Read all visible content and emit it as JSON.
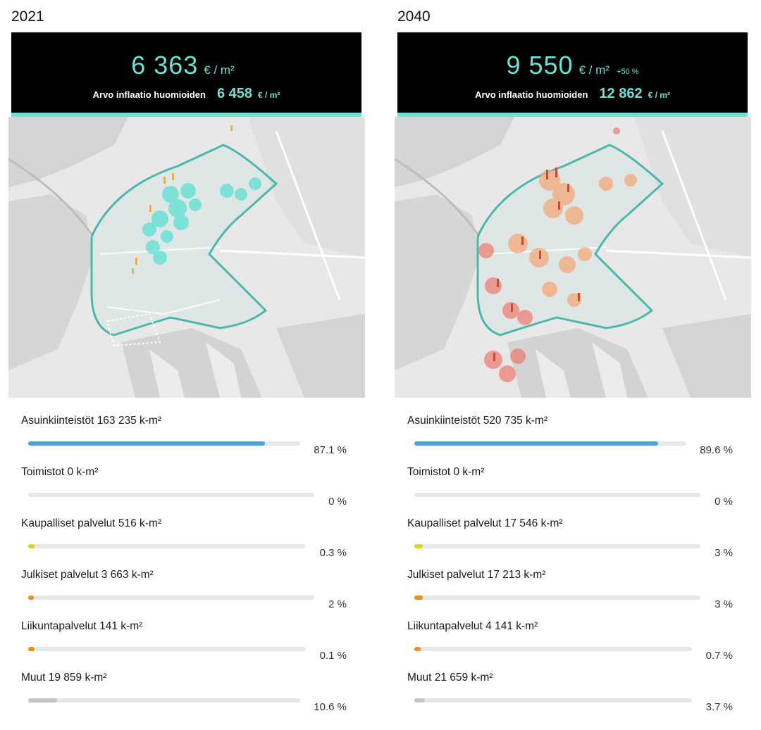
{
  "colors": {
    "accent": "#6ee0d6",
    "bar_blue": "#4aa3d8",
    "bar_yellow": "#d9d71c",
    "bar_orange": "#e8901a",
    "bar_gray": "#c4c4c4"
  },
  "panels": [
    {
      "year": "2021",
      "price": "6 363",
      "price_unit": "€ / m²",
      "price_change": "",
      "inflation_label": "Arvo inflaatio huomioiden",
      "inflation_value": "6 458",
      "inflation_unit": "€ / m²",
      "map_icon": "city-map-with-building-markers",
      "stats": [
        {
          "label": "Asuinkiinteistöt 163 235 k-m²",
          "percent": "87.1 %",
          "share": 0.871,
          "color": "#4aa3d8"
        },
        {
          "label": "Toimistot 0 k-m²",
          "percent": "0 %",
          "share": 0,
          "color": "#4aa3d8"
        },
        {
          "label": "Kaupalliset palvelut 516 k-m²",
          "percent": "0.3 %",
          "share": 0.003,
          "color": "#d9d71c"
        },
        {
          "label": "Julkiset palvelut 3 663 k-m²",
          "percent": "2 %",
          "share": 0.02,
          "color": "#e8901a"
        },
        {
          "label": "Liikuntapalvelut 141 k-m²",
          "percent": "0.1 %",
          "share": 0.001,
          "color": "#e8901a"
        },
        {
          "label": "Muut 19 859 k-m²",
          "percent": "10.6 %",
          "share": 0.106,
          "color": "#c4c4c4"
        }
      ]
    },
    {
      "year": "2040",
      "price": "9 550",
      "price_unit": "€ / m²",
      "price_change": "+50 %",
      "inflation_label": "Arvo inflaatio huomioiden",
      "inflation_value": "12 862",
      "inflation_unit": "€ / m²",
      "map_icon": "city-map-with-building-markers",
      "stats": [
        {
          "label": "Asuinkiinteistöt 520 735 k-m²",
          "percent": "89.6 %",
          "share": 0.896,
          "color": "#4aa3d8"
        },
        {
          "label": "Toimistot 0 k-m²",
          "percent": "0 %",
          "share": 0,
          "color": "#4aa3d8"
        },
        {
          "label": "Kaupalliset palvelut 17 546 k-m²",
          "percent": "3 %",
          "share": 0.03,
          "color": "#d9d71c"
        },
        {
          "label": "Julkiset palvelut 17 213 k-m²",
          "percent": "3 %",
          "share": 0.03,
          "color": "#e8901a"
        },
        {
          "label": "Liikuntapalvelut 4 141 k-m²",
          "percent": "0.7 %",
          "share": 0.007,
          "color": "#e8901a"
        },
        {
          "label": "Muut 21 659 k-m²",
          "percent": "3.7 %",
          "share": 0.037,
          "color": "#c4c4c4"
        }
      ]
    }
  ]
}
